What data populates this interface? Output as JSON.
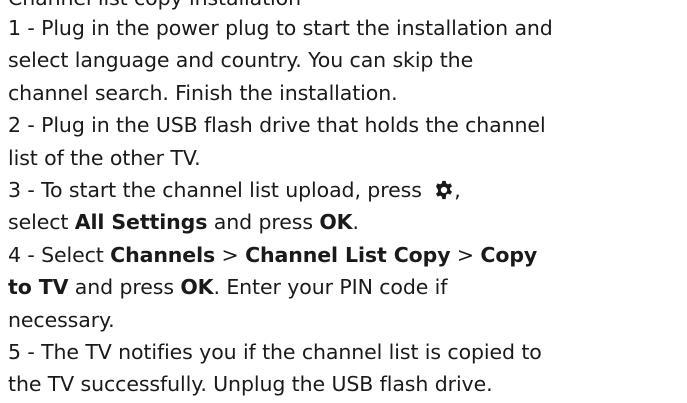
{
  "heading_partial": "Channel list copy installation",
  "steps": {
    "s1": {
      "l1": "1 -  Plug in the power plug to start the installation and",
      "l2": "select language and country. You can skip the",
      "l3": "channel search. Finish the installation."
    },
    "s2": {
      "l1": "2 -  Plug in the USB flash drive that holds the channel",
      "l2": "list of the other TV."
    },
    "s3": {
      "prefix": "3 -  To start the channel list upload, press ",
      "l2_pre": "select  ",
      "all_settings": "All Settings",
      "and_press": " and press   ",
      "ok": "OK",
      "end": "."
    },
    "s4": {
      "prefix": "4 -  Select  ",
      "channels": "Channels",
      "sep": " >  ",
      "channel_list_copy": "Channel List Copy",
      "sep2": " >    ",
      "copy": "Copy",
      "to_tv": "to TV",
      "and_press": " and press   ",
      "ok": "OK",
      "tail": ". Enter your PIN code if",
      "l3": "necessary."
    },
    "s5": {
      "l1": "5 -  The TV notifies you if the channel list is copied to",
      "l2": "the TV successfully. Unplug the USB flash drive."
    }
  },
  "icons": {
    "settings": "gear-icon"
  },
  "colors": {
    "text": "#1a1a1a",
    "background": "#ffffff"
  }
}
